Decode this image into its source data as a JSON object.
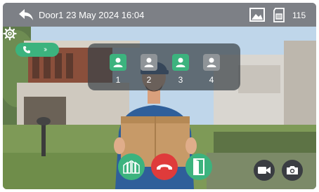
{
  "topbar": {
    "title": "Door1 23 May 2024 16:04",
    "count": "115",
    "icons": [
      "back-arrow-icon",
      "image-icon",
      "sd-card-icon"
    ]
  },
  "cameras": [
    {
      "label": "1",
      "active": true
    },
    {
      "label": "2",
      "active": false
    },
    {
      "label": "3",
      "active": true
    },
    {
      "label": "4",
      "active": false
    }
  ],
  "controls": {
    "call_status_icons": [
      "phone-icon",
      "double-chevron-icon"
    ],
    "settings_icon": "gear-icon",
    "buttons": [
      "unlock-gate-icon",
      "hang-up-icon",
      "unlock-door-icon",
      "record-video-icon",
      "snapshot-camera-icon"
    ]
  },
  "colors": {
    "accent_green": "#3cb37e",
    "hangup_red": "#df3b3b",
    "topbar_gray": "#7d8086"
  }
}
